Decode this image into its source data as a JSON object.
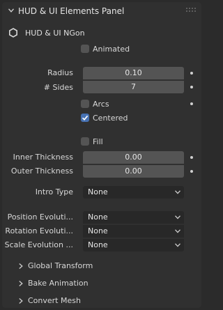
{
  "panel": {
    "title": "HUD & UI Elements Panel"
  },
  "sub": {
    "title": "HUD & UI NGon"
  },
  "checks": {
    "animated": {
      "label": "Animated",
      "checked": false
    },
    "arcs": {
      "label": "Arcs",
      "checked": false
    },
    "centered": {
      "label": "Centered",
      "checked": true
    },
    "fill": {
      "label": "Fill",
      "checked": false
    }
  },
  "fields": {
    "radius": {
      "label": "Radius",
      "value": "0.10"
    },
    "sides": {
      "label": "# Sides",
      "value": "7"
    },
    "inner_thickness": {
      "label": "Inner Thickness",
      "value": "0.00"
    },
    "outer_thickness": {
      "label": "Outer Thickness",
      "value": "0.00"
    }
  },
  "selects": {
    "intro_type": {
      "label": "Intro Type",
      "value": "None"
    },
    "position_evolution": {
      "label": "Position Evoluti...",
      "value": "None"
    },
    "rotation_evolution": {
      "label": "Rotation Evoluti...",
      "value": "None"
    },
    "scale_evolution": {
      "label": "Scale Evolution ...",
      "value": "None"
    }
  },
  "sections": {
    "global_transform": "Global Transform",
    "bake_animation": "Bake Animation",
    "convert_mesh": "Convert Mesh"
  },
  "colors": {
    "background": "#2b2b2b",
    "panel": "#303030",
    "field": "#545454",
    "dropdown": "#282828",
    "accent": "#4772b3"
  }
}
